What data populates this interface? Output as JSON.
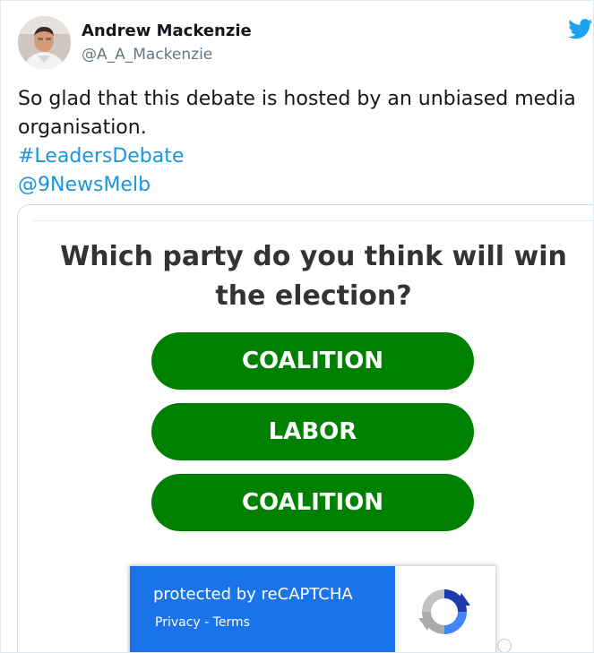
{
  "author": {
    "display_name": "Andrew Mackenzie",
    "handle": "@A_A_Mackenzie"
  },
  "icons": {
    "avatar": "avatar-photo",
    "brand": "twitter-bird-icon",
    "recaptcha": "recaptcha-logo-icon"
  },
  "tweet": {
    "text_line1": "So glad that this debate is hosted by an unbiased media",
    "text_line2": "organisation.",
    "hashtag": "#LeadersDebate",
    "mention": "@9NewsMelb"
  },
  "poll": {
    "question": "Which party do you think will win the election?",
    "options": [
      "COALITION",
      "LABOR",
      "COALITION"
    ]
  },
  "recaptcha": {
    "title": "protected by reCAPTCHA",
    "privacy": "Privacy",
    "separator": "-",
    "terms": "Terms"
  },
  "colors": {
    "link": "#1b95e0",
    "option_green": "#008000",
    "recaptcha_blue": "#1a73e8",
    "twitter_blue": "#1da1f2"
  }
}
